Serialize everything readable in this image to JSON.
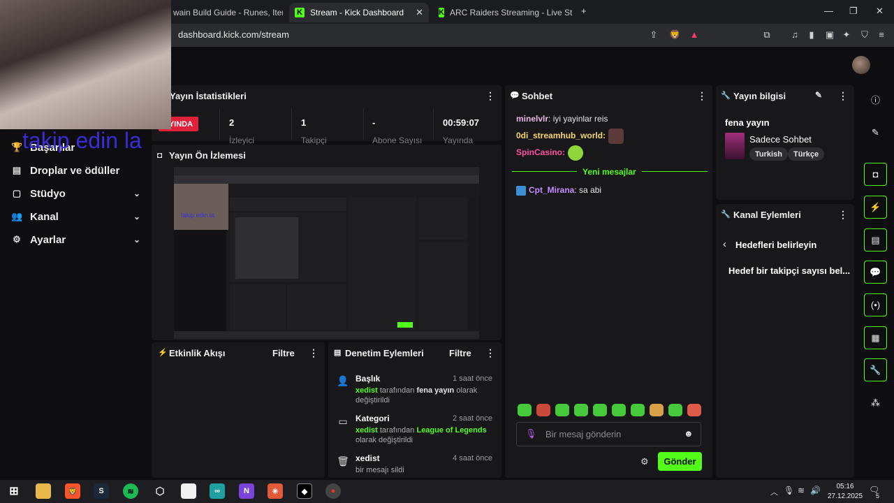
{
  "browser": {
    "tabs": [
      {
        "label": "wain Build Guide - Runes, Items & N"
      },
      {
        "label": "Stream - Kick Dashboard"
      },
      {
        "label": "ARC Raiders Streaming - Live Stream"
      }
    ],
    "url": "dashboard.kick.com/stream"
  },
  "webcam": {
    "overlay_text": "takip edin la"
  },
  "nav": {
    "items": [
      {
        "label": "Başarılar",
        "icon": "trophy-icon"
      },
      {
        "label": "Droplar ve ödüller",
        "icon": "gift-icon"
      },
      {
        "label": "Stüdyo",
        "icon": "studio-icon"
      },
      {
        "label": "Kanal",
        "icon": "users-icon"
      },
      {
        "label": "Ayarlar",
        "icon": "gear-icon"
      }
    ]
  },
  "stats": {
    "title": "Yayın İstatistikleri",
    "live_badge": "YAYINDA",
    "badge_visible": "AYINDA",
    "columns": [
      {
        "value": "2",
        "label": "İzleyici"
      },
      {
        "value": "1",
        "label": "Takipçi"
      },
      {
        "value": "-",
        "label": "Abone Sayısı"
      },
      {
        "value": "00:59:07",
        "label": "Yayında"
      }
    ]
  },
  "preview": {
    "title": "Yayın Ön İzlemesi"
  },
  "activity": {
    "title": "Etkinlik Akışı",
    "filter": "Filtre"
  },
  "moderation": {
    "title": "Denetim Eylemleri",
    "filter": "Filtre",
    "items": [
      {
        "title": "Başlık",
        "time": "1 saat önce",
        "user": "xedist",
        "mid": "tarafından",
        "value": "fena yayın",
        "tail": "olarak değiştirildi"
      },
      {
        "title": "Kategori",
        "time": "2 saat önce",
        "user": "xedist",
        "mid": "tarafından",
        "value": "League of Legends",
        "tail": "olarak değiştirildi"
      },
      {
        "title": "xedist",
        "time": "4 saat önce",
        "desc": "bir mesajı sildi"
      }
    ]
  },
  "chat": {
    "title": "Sohbet",
    "messages": [
      {
        "user": "minelvlr",
        "color": "#e7b6e6",
        "text": "iyi yayinlar reis"
      },
      {
        "user": "0di_streamhub_world",
        "color": "#f5d76e",
        "text": ""
      },
      {
        "user": "SpinCasino",
        "color": "#ff4fa3",
        "text": ""
      }
    ],
    "new_messages": "Yeni mesajlar",
    "after": [
      {
        "user": "Cpt_Mirana",
        "color": "#c58bff",
        "text": "sa abi"
      }
    ],
    "input_placeholder": "Bir mesaj gönderin",
    "send": "Gönder"
  },
  "stream_info": {
    "title": "Yayın bilgisi",
    "stream_title": "fena yayın",
    "category": "Sadece Sohbet",
    "tags": [
      "Turkish",
      "Türkçe"
    ]
  },
  "channel_actions": {
    "title": "Kanal Eylemleri",
    "back_label": "Hedefleri belirleyin",
    "goal_item": "Hedef bir takipçi sayısı bel..."
  },
  "taskbar": {
    "time": "05:16",
    "date": "27.12.2025",
    "notifications": "5"
  },
  "colors": {
    "accent": "#53fc18",
    "live": "#e1203c"
  }
}
